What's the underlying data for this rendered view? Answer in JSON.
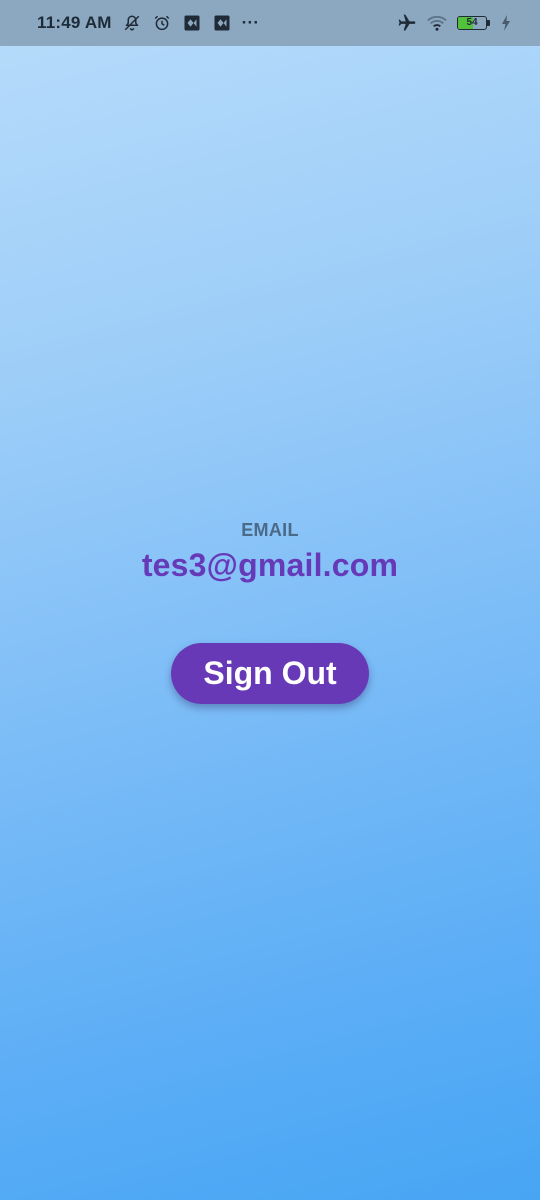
{
  "status_bar": {
    "time": "11:49 AM",
    "more": "···",
    "battery_level": "54",
    "battery_fraction": 0.54,
    "icons_left": [
      "notifications-off-icon",
      "alarm-icon",
      "app-notification-icon",
      "app-notification-icon"
    ],
    "icons_right": [
      "airplane-mode-icon",
      "wifi-icon",
      "battery-icon",
      "charging-icon"
    ]
  },
  "profile": {
    "email_label": "EMAIL",
    "email_value": "tes3@gmail.com"
  },
  "actions": {
    "sign_out_label": "Sign Out"
  },
  "colors": {
    "accent": "#6739b7",
    "label": "#4a6a87",
    "status_bar": "#8ca8c0",
    "background_top": "#b8dcfb",
    "background_bottom": "#47a5f4"
  }
}
